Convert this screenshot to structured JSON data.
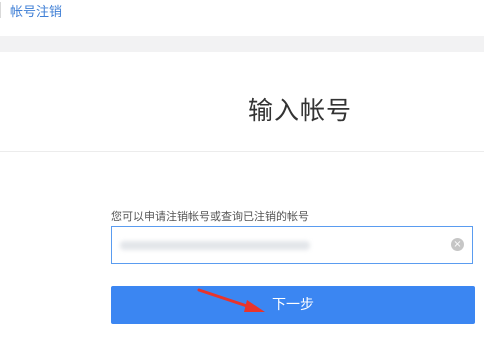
{
  "breadcrumb": {
    "label": "帐号注销"
  },
  "page": {
    "title": "输入帐号",
    "hint": "您可以申请注销帐号或查询已注销的帐号"
  },
  "account_input": {
    "value": "",
    "clear_icon": "clear-circle-icon"
  },
  "actions": {
    "next_label": "下一步"
  },
  "colors": {
    "accent": "#3b86f2",
    "link": "#3f7fd6",
    "arrow": "#e8342c"
  }
}
